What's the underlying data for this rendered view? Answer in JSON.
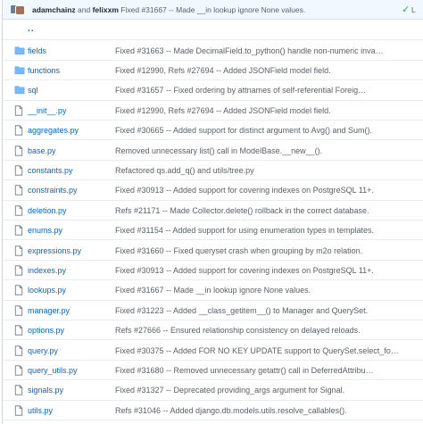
{
  "latest_commit": {
    "author": "adamchainz",
    "conjunction": "and",
    "coauthor": "felixxm",
    "message": "Fixed #31667 -- Made __in lookup ignore None values.",
    "status_icon": "check-icon",
    "latest_label": "L"
  },
  "up_link": "..",
  "rows": [
    {
      "name": "fields",
      "type": "folder",
      "message": "Fixed #31663 -- Made DecimalField.to_python() handle non-numeric inva…"
    },
    {
      "name": "functions",
      "type": "folder",
      "message": "Fixed #12990, Refs #27694 -- Added JSONField model field."
    },
    {
      "name": "sql",
      "type": "folder",
      "message": "Fixed #31657 -- Fixed ordering by attnames of self-referential Foreig…"
    },
    {
      "name": "__init__.py",
      "type": "file",
      "message": "Fixed #12990, Refs #27694 -- Added JSONField model field."
    },
    {
      "name": "aggregates.py",
      "type": "file",
      "message": "Fixed #30665 -- Added support for distinct argument to Avg() and Sum()."
    },
    {
      "name": "base.py",
      "type": "file",
      "message": "Removed unnecessary list() call in ModelBase.__new__()."
    },
    {
      "name": "constants.py",
      "type": "file",
      "message": "Refactored qs.add_q() and utils/tree.py"
    },
    {
      "name": "constraints.py",
      "type": "file",
      "message": "Fixed #30913 -- Added support for covering indexes on PostgreSQL 11+."
    },
    {
      "name": "deletion.py",
      "type": "file",
      "message": "Refs #21171 -- Made Collector.delete() rollback in the correct database."
    },
    {
      "name": "enums.py",
      "type": "file",
      "message": "Fixed #31154 -- Added support for using enumeration types in templates."
    },
    {
      "name": "expressions.py",
      "type": "file",
      "message": "Fixed #31660 -- Fixed queryset crash when grouping by m2o relation."
    },
    {
      "name": "indexes.py",
      "type": "file",
      "message": "Fixed #30913 -- Added support for covering indexes on PostgreSQL 11+."
    },
    {
      "name": "lookups.py",
      "type": "file",
      "message": "Fixed #31667 -- Made __in lookup ignore None values."
    },
    {
      "name": "manager.py",
      "type": "file",
      "message": "Fixed #31223 -- Added __class_getitem__() to Manager and QuerySet."
    },
    {
      "name": "options.py",
      "type": "file",
      "message": "Refs #27666 -- Ensured relationship consistency on delayed reloads."
    },
    {
      "name": "query.py",
      "type": "file",
      "message": "Fixed #30375 -- Added FOR NO KEY UPDATE support to QuerySet.select_fo…"
    },
    {
      "name": "query_utils.py",
      "type": "file",
      "message": "Fixed #31680 -- Removed unnecessary getattr() call in DeferredAttribu…"
    },
    {
      "name": "signals.py",
      "type": "file",
      "message": "Fixed #31327 -- Deprecated providing_args argument for Signal."
    },
    {
      "name": "utils.py",
      "type": "file",
      "message": "Refs #31046 -- Added django.db.models.utils.resolve_callables()."
    }
  ]
}
